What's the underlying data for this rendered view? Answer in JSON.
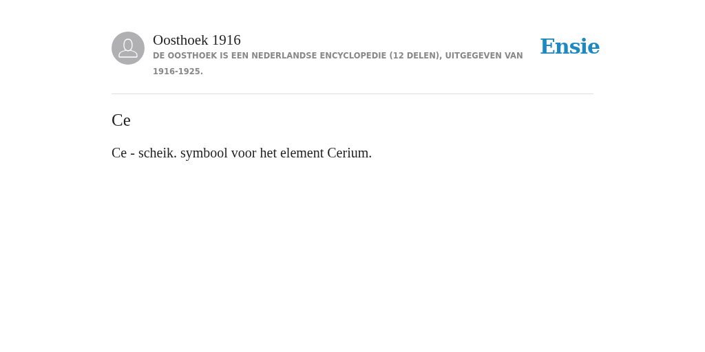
{
  "source": {
    "name": "Oosthoek 1916",
    "description": "DE OOSTHOEK IS EEN NEDERLANDSE ENCYCLOPEDIE (12 DELEN), UITGEGEVEN VAN 1916-1925."
  },
  "logo": "Ensie",
  "article": {
    "title": "Ce",
    "body": "Ce - scheik. symbool voor het element Cerium."
  }
}
